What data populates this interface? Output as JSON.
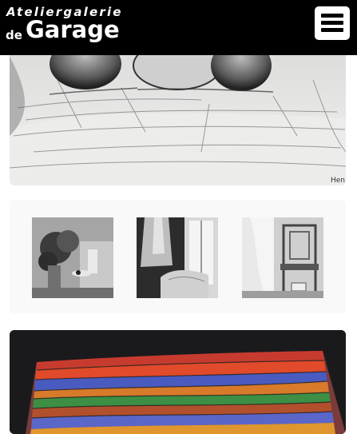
{
  "header": {
    "logo_line1": "Ateliergalerie",
    "logo_de": "de",
    "logo_garage": "Garage",
    "menu_icon": "hamburger-menu-icon"
  },
  "gallery": {
    "drawing_signature": "Hen"
  },
  "colors": {
    "header_bg": "#000000",
    "header_text": "#ffffff",
    "page_bg": "#ffffff"
  }
}
